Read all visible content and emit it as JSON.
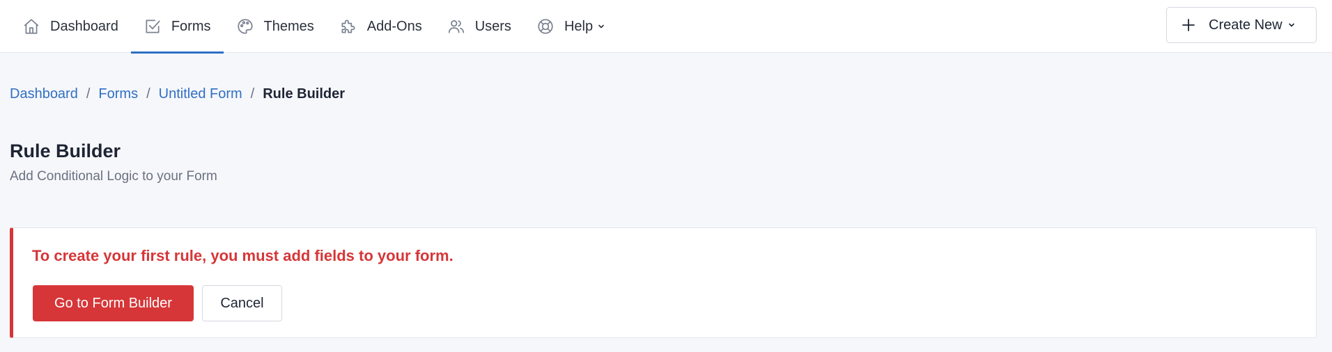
{
  "nav": {
    "items": [
      {
        "label": "Dashboard",
        "icon": "home-icon"
      },
      {
        "label": "Forms",
        "icon": "checkbox-icon",
        "active": true
      },
      {
        "label": "Themes",
        "icon": "palette-icon"
      },
      {
        "label": "Add-Ons",
        "icon": "puzzle-icon"
      },
      {
        "label": "Users",
        "icon": "users-icon"
      },
      {
        "label": "Help",
        "icon": "lifebuoy-icon"
      }
    ],
    "create_new_label": "Create New"
  },
  "breadcrumb": {
    "items": [
      "Dashboard",
      "Forms",
      "Untitled Form"
    ],
    "current": "Rule Builder",
    "separator": "/"
  },
  "page": {
    "title": "Rule Builder",
    "subtitle": "Add Conditional Logic to your Form"
  },
  "alert": {
    "message": "To create your first rule, you must add fields to your form.",
    "primary_label": "Go to Form Builder",
    "secondary_label": "Cancel"
  },
  "colors": {
    "accent": "#2f6fc4",
    "danger": "#d63638",
    "background": "#f6f7fb"
  }
}
